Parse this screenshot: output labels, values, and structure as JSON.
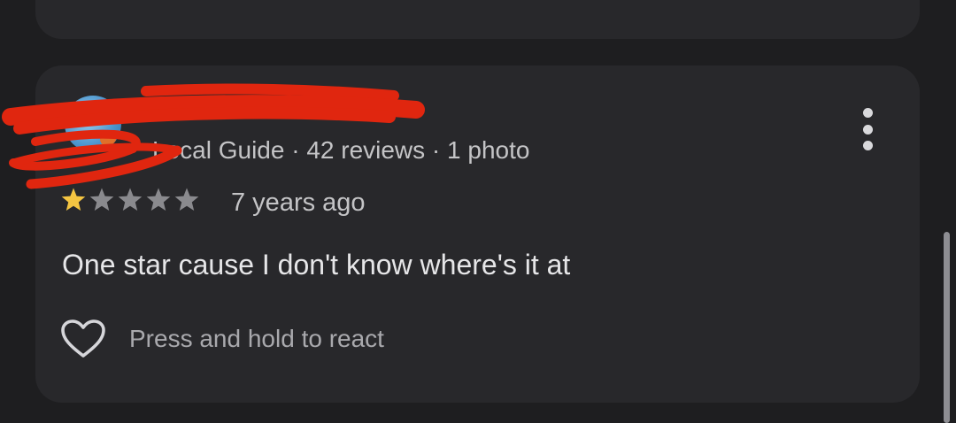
{
  "review": {
    "reviewer_meta": "Local Guide · 42 reviews · 1 photo",
    "rating": 1,
    "rating_max": 5,
    "time_ago": "7 years ago",
    "text": "One star cause I don't know where's it at",
    "react_label": "Press and hold to react"
  },
  "colors": {
    "background": "#1e1e20",
    "card": "#28282b",
    "star_filled": "#f4c542",
    "star_empty": "#8a8a8e",
    "redaction": "#e0260f"
  },
  "icons": {
    "avatar": "reviewer-avatar",
    "menu": "more-vertical-icon",
    "react": "heart-outline-icon"
  }
}
